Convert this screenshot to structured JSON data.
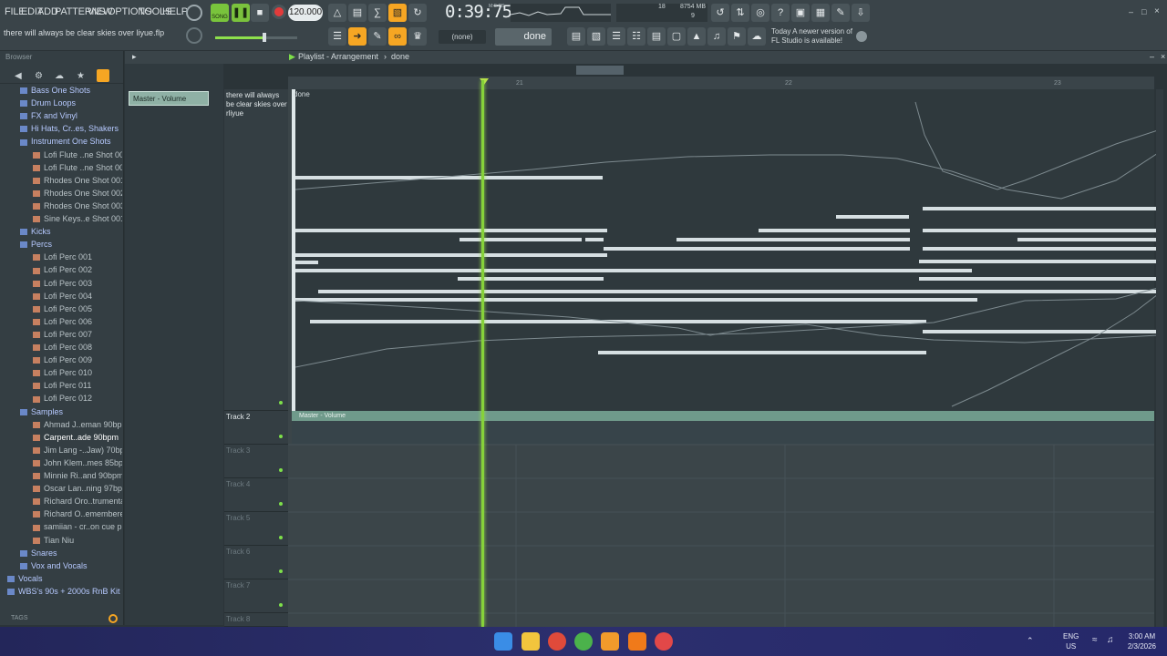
{
  "menu": [
    "FILE",
    "EDIT",
    "ADD",
    "PATTERNS",
    "VIEW",
    "OPTIONS",
    "TOOLS",
    "HELP"
  ],
  "transport": {
    "mode": "SONG",
    "tempo": "120.000",
    "time": "0:39:75",
    "time_label": "M:S:CS",
    "cpu": "18",
    "mem": "8754 MB",
    "poly": "9"
  },
  "project": {
    "title": "there will always be clear skies over liyue.flp",
    "pattern_none": "(none)",
    "pattern_name": "done"
  },
  "notice": {
    "line1": "Today  A newer version of",
    "line2": "FL Studio is available!"
  },
  "browser": {
    "label": "Browser",
    "items": [
      {
        "label": "Bass One Shots",
        "kind": "folder",
        "depth": 1
      },
      {
        "label": "Drum Loops",
        "kind": "folder",
        "depth": 1
      },
      {
        "label": "FX and Vinyl",
        "kind": "folder",
        "depth": 1
      },
      {
        "label": "Hi Hats, Cr..es, Shakers",
        "kind": "folder",
        "depth": 1
      },
      {
        "label": "Instrument One Shots",
        "kind": "folder",
        "depth": 1
      },
      {
        "label": "Lofi Flute ..ne Shot 001",
        "kind": "file",
        "depth": 2
      },
      {
        "label": "Lofi Flute ..ne Shot 002",
        "kind": "file",
        "depth": 2
      },
      {
        "label": "Rhodes One Shot 001",
        "kind": "file",
        "depth": 2
      },
      {
        "label": "Rhodes One Shot 002",
        "kind": "file",
        "depth": 2
      },
      {
        "label": "Rhodes One Shot 003",
        "kind": "file",
        "depth": 2
      },
      {
        "label": "Sine Keys..e Shot 001",
        "kind": "file",
        "depth": 2
      },
      {
        "label": "Kicks",
        "kind": "folder",
        "depth": 1
      },
      {
        "label": "Percs",
        "kind": "folder",
        "depth": 1
      },
      {
        "label": "Lofi Perc 001",
        "kind": "file",
        "depth": 2
      },
      {
        "label": "Lofi Perc 002",
        "kind": "file",
        "depth": 2
      },
      {
        "label": "Lofi Perc 003",
        "kind": "file",
        "depth": 2
      },
      {
        "label": "Lofi Perc 004",
        "kind": "file",
        "depth": 2
      },
      {
        "label": "Lofi Perc 005",
        "kind": "file",
        "depth": 2
      },
      {
        "label": "Lofi Perc 006",
        "kind": "file",
        "depth": 2
      },
      {
        "label": "Lofi Perc 007",
        "kind": "file",
        "depth": 2
      },
      {
        "label": "Lofi Perc 008",
        "kind": "file",
        "depth": 2
      },
      {
        "label": "Lofi Perc 009",
        "kind": "file",
        "depth": 2
      },
      {
        "label": "Lofi Perc 010",
        "kind": "file",
        "depth": 2
      },
      {
        "label": "Lofi Perc 011",
        "kind": "file",
        "depth": 2
      },
      {
        "label": "Lofi Perc 012",
        "kind": "file",
        "depth": 2
      },
      {
        "label": "Samples",
        "kind": "folder",
        "depth": 1
      },
      {
        "label": "Ahmad J..eman 90bpm",
        "kind": "file",
        "depth": 2
      },
      {
        "label": "Carpent..ade 90bpm",
        "kind": "file",
        "depth": 2,
        "selected": true
      },
      {
        "label": "Jim Lang -..Jaw) 70bpm",
        "kind": "file",
        "depth": 2
      },
      {
        "label": "John Klem..mes 85bpm",
        "kind": "file",
        "depth": 2
      },
      {
        "label": "Minnie Ri..and 90bpm",
        "kind": "file",
        "depth": 2
      },
      {
        "label": "Oscar Lan..ning 97bpm",
        "kind": "file",
        "depth": 2
      },
      {
        "label": "Richard Oro..trumental",
        "kind": "file",
        "depth": 2
      },
      {
        "label": "Richard O..emembered",
        "kind": "file",
        "depth": 2
      },
      {
        "label": "samiian - cr..on cue pls",
        "kind": "file",
        "depth": 2
      },
      {
        "label": "Tian Niu",
        "kind": "file",
        "depth": 2
      },
      {
        "label": "Snares",
        "kind": "folder",
        "depth": 1
      },
      {
        "label": "Vox and Vocals",
        "kind": "folder",
        "depth": 1
      },
      {
        "label": "Vocals",
        "kind": "folder",
        "depth": 0
      },
      {
        "label": "WBS's 90s + 2000s RnB Kit",
        "kind": "folder",
        "depth": 0
      }
    ],
    "tags": "TAGS"
  },
  "playlist": {
    "title": "Playlist - Arrangement",
    "breadcrumb": "done",
    "auto_clip": "Master - Volume",
    "track1_label": "there will always be clear skies over rliyue",
    "clip1_title": "done",
    "clip2_title": "Master - Volume",
    "ruler": [
      "21",
      "22",
      "23"
    ],
    "tracks": [
      "Track 2",
      "Track 3",
      "Track 4",
      "Track 5",
      "Track 6",
      "Track 7",
      "Track 8"
    ]
  },
  "taskbar": {
    "lang1": "ENG",
    "lang2": "US",
    "time": "3:00 AM",
    "date": "2/3/2026"
  },
  "colors": {
    "accent": "#f6a623",
    "playhead": "#86d23a",
    "clip": "#8fb1a5"
  }
}
